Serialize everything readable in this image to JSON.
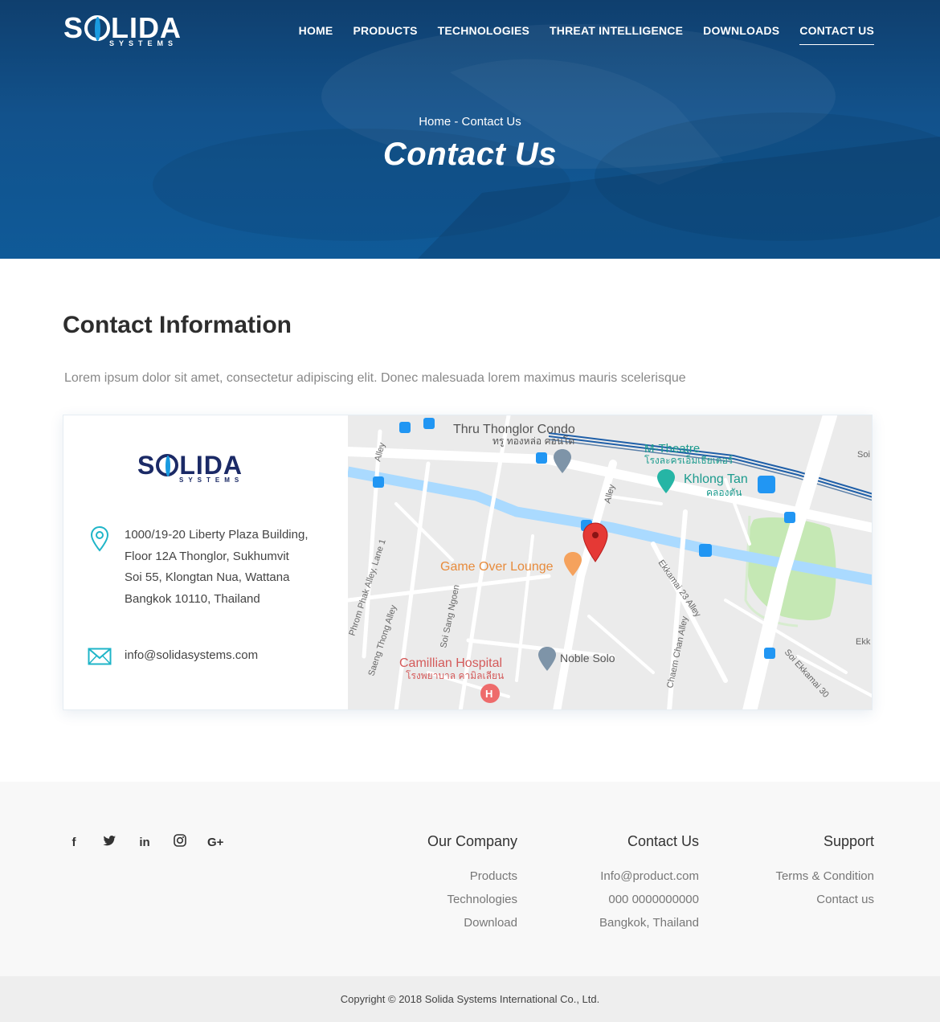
{
  "brand": {
    "name": "SOLIDA",
    "tagline": "SYSTEMS",
    "name_part1": "S",
    "name_part2": "LIDA"
  },
  "nav": {
    "items": [
      {
        "label": "HOME"
      },
      {
        "label": "PRODUCTS"
      },
      {
        "label": "TECHNOLOGIES"
      },
      {
        "label": "THREAT INTELLIGENCE"
      },
      {
        "label": "DOWNLOADS"
      },
      {
        "label": "CONTACT US",
        "active": true
      }
    ]
  },
  "hero": {
    "breadcrumb": "Home - Contact Us",
    "title": "Contact Us"
  },
  "contact": {
    "title": "Contact Information",
    "description": "Lorem ipsum dolor sit amet, consectetur adipiscing elit. Donec malesuada lorem maximus mauris scelerisque",
    "address_lines": [
      "1000/19-20 Liberty Plaza Building,",
      "Floor 12A Thonglor, Sukhumvit",
      "Soi 55, Klongtan Nua, Wattana",
      "Bangkok 10110, Thailand"
    ],
    "email": "info@solidasystems.com"
  },
  "map": {
    "labels": {
      "thru_thonglor": "Thru Thonglor Condo",
      "thru_thonglor_th": "ทรู ทองหล่อ คอนโด",
      "m_theatre": "M-Theatre",
      "m_theatre_th": "โรงละครเอ็มเธียเตอร์",
      "khlong_tan": "Khlong Tan",
      "khlong_tan_th": "คลองตัน",
      "game_over": "Game Over Lounge",
      "camillian": "Camillian Hospital",
      "camillian_th": "โรงพยาบาล คามิลเลียน",
      "noble_solo": "Noble Solo",
      "alley1": "Alley",
      "alley2": "Alley",
      "phrom_phak": "Phrom Phak Alley, Lane 1",
      "saeng_thong": "Saeng Thong Alley",
      "soi_sang_ngoen": "Soi Sang Ngoen",
      "ekkamai_23": "Ekkamai 23 Alley",
      "chaem_chan": "Chaem Chan Alley",
      "soi_ekkamai_30": "Soi Ekkamai 30",
      "ekk": "Ekk",
      "soi": "Soi"
    },
    "accent_colors": {
      "water": "#aadaff",
      "park": "#c5e8b4",
      "marker": "#e53935",
      "rail": "#1f5fa8"
    }
  },
  "footer": {
    "socials": [
      {
        "icon": "facebook-icon",
        "glyph": "f"
      },
      {
        "icon": "twitter-icon",
        "glyph": "t"
      },
      {
        "icon": "linkedin-icon",
        "glyph": "in"
      },
      {
        "icon": "instagram-icon",
        "glyph": "◎"
      },
      {
        "icon": "google-plus-icon",
        "glyph": "G+"
      }
    ],
    "company": {
      "title": "Our Company",
      "links": [
        "Products",
        "Technologies",
        "Download"
      ]
    },
    "contact": {
      "title": "Contact Us",
      "links": [
        "Info@product.com",
        "000 0000000000",
        "Bangkok, Thailand"
      ]
    },
    "support": {
      "title": "Support",
      "links": [
        "Terms & Condition",
        "Contact us"
      ]
    },
    "copyright": "Copyright © 2018 Solida Systems International Co., Ltd."
  }
}
